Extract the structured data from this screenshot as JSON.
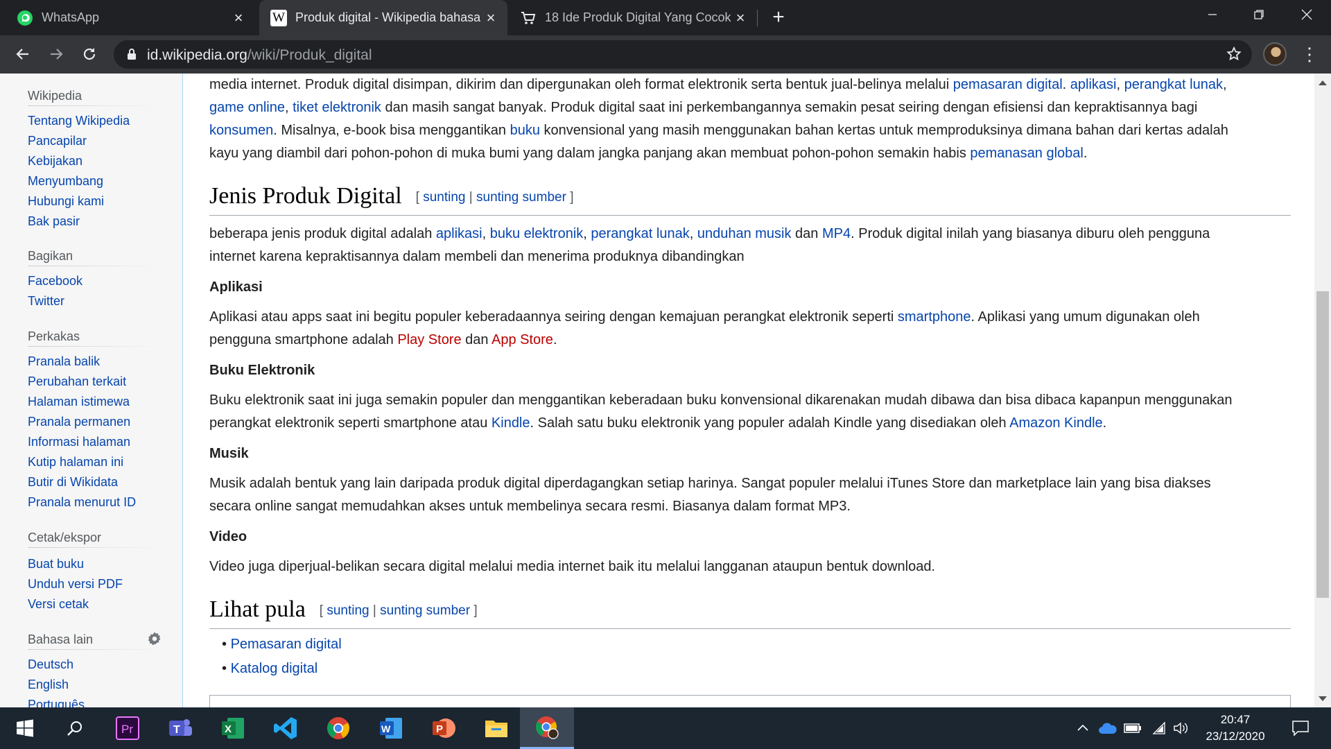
{
  "browser": {
    "tabs": [
      {
        "title": "WhatsApp",
        "icon": "whatsapp-icon",
        "active": false
      },
      {
        "title": "Produk digital - Wikipedia bahasa Indonesia",
        "icon": "wikipedia-icon",
        "active": true
      },
      {
        "title": "18 Ide Produk Digital Yang Cocok",
        "icon": "cart-icon",
        "active": false
      }
    ],
    "url_host": "id.wikipedia.org",
    "url_path": "/wiki/Produk_digital"
  },
  "sidebar": {
    "sections": [
      {
        "heading": "Wikipedia",
        "items": [
          "Tentang Wikipedia",
          "Pancapilar",
          "Kebijakan",
          "Menyumbang",
          "Hubungi kami",
          "Bak pasir"
        ]
      },
      {
        "heading": "Bagikan",
        "items": [
          "Facebook",
          "Twitter"
        ]
      },
      {
        "heading": "Perkakas",
        "items": [
          "Pranala balik",
          "Perubahan terkait",
          "Halaman istimewa",
          "Pranala permanen",
          "Informasi halaman",
          "Kutip halaman ini",
          "Butir di Wikidata",
          "Pranala menurut ID"
        ]
      },
      {
        "heading": "Cetak/ekspor",
        "items": [
          "Buat buku",
          "Unduh versi PDF",
          "Versi cetak"
        ]
      },
      {
        "heading": "Bahasa lain",
        "items": [
          "Deutsch",
          "English",
          "Português"
        ]
      }
    ]
  },
  "article": {
    "intro": {
      "l1a": "media internet. Produk digital disimpan, dikirim dan dipergunakan oleh format elektronik serta bentuk jual-belinya melalui ",
      "l1_link1": "pemasaran digital",
      "l1b": ". ",
      "l1_link2": "aplikasi",
      "l1c": ", ",
      "l1_link3": "perangkat lunak",
      "l1d": ",",
      "l2_link1": "game online",
      "l2a": ", ",
      "l2_link2": "tiket elektronik",
      "l2b": " dan masih sangat banyak. Produk digital saat ini perkembangannya semakin pesat seiring dengan efisiensi dan kepraktisannya bagi",
      "l3_link1": "konsumen",
      "l3a": ". Misalnya, e-book bisa menggantikan ",
      "l3_link2": "buku",
      "l3b": " konvensional yang masih menggunakan bahan kertas untuk memproduksinya dimana bahan dari kertas adalah",
      "l4a": "kayu yang diambil dari pohon-pohon di muka bumi yang dalam jangka panjang akan membuat pohon-pohon semakin habis ",
      "l4_link1": "pemanasan global",
      "l4b": "."
    },
    "edit": {
      "open": "[ ",
      "sunting": "sunting",
      "sep": " | ",
      "sunting_sumber": "sunting sumber",
      "close": " ]"
    },
    "section_jenis": {
      "heading": "Jenis Produk Digital",
      "l1a": "beberapa jenis produk digital adalah ",
      "link1": "aplikasi",
      "c1": ", ",
      "link2": "buku elektronik",
      "c2": ", ",
      "link3": "perangkat lunak",
      "c3": ", ",
      "link4": "unduhan musik",
      "c4": " dan ",
      "link5": "MP4",
      "l1b": ". Produk digital inilah yang biasanya diburu oleh pengguna",
      "l2": "internet karena kepraktisannya dalam membeli dan menerima produknya dibandingkan"
    },
    "aplikasi": {
      "heading": "Aplikasi",
      "l1a": "Aplikasi atau apps saat ini begitu populer keberadaannya seiring dengan kemajuan perangkat elektronik seperti ",
      "link1": "smartphone",
      "l1b": ". Aplikasi yang umum digunakan oleh",
      "l2a": "pengguna smartphone adalah ",
      "link2": "Play Store",
      "l2b": " dan ",
      "link3": "App Store",
      "l2c": "."
    },
    "buku": {
      "heading": "Buku Elektronik",
      "l1": "Buku elektronik saat ini juga semakin populer dan menggantikan keberadaan buku konvensional dikarenakan mudah dibawa dan bisa dibaca kapanpun menggunakan",
      "l2a": "perangkat elektronik seperti smartphone atau ",
      "link1": "Kindle",
      "l2b": ". Salah satu buku elektronik yang populer adalah Kindle yang disediakan oleh ",
      "link2": "Amazon Kindle",
      "l2c": "."
    },
    "musik": {
      "heading": "Musik",
      "l1": "Musik adalah bentuk yang lain daripada produk digital diperdagangkan setiap harinya. Sangat populer melalui iTunes Store dan marketplace lain yang bisa diakses",
      "l2": "secara online sangat memudahkan akses untuk membelinya secara resmi. Biasanya dalam format MP3."
    },
    "video": {
      "heading": "Video",
      "l1": "Video juga diperjual-belikan secara digital melalui media internet baik itu melalui langganan ataupun bentuk download."
    },
    "lihat": {
      "heading": "Lihat pula",
      "items": [
        "Pemasaran digital",
        "Katalog digital"
      ]
    }
  },
  "taskbar": {
    "time": "20:47",
    "date": "23/12/2020",
    "apps": [
      "start-icon",
      "search-icon",
      "premiere-icon",
      "teams-icon",
      "excel-icon",
      "vscode-icon",
      "chrome-icon",
      "word-icon",
      "powerpoint-icon",
      "file-explorer-icon",
      "chrome-profile-icon"
    ]
  }
}
